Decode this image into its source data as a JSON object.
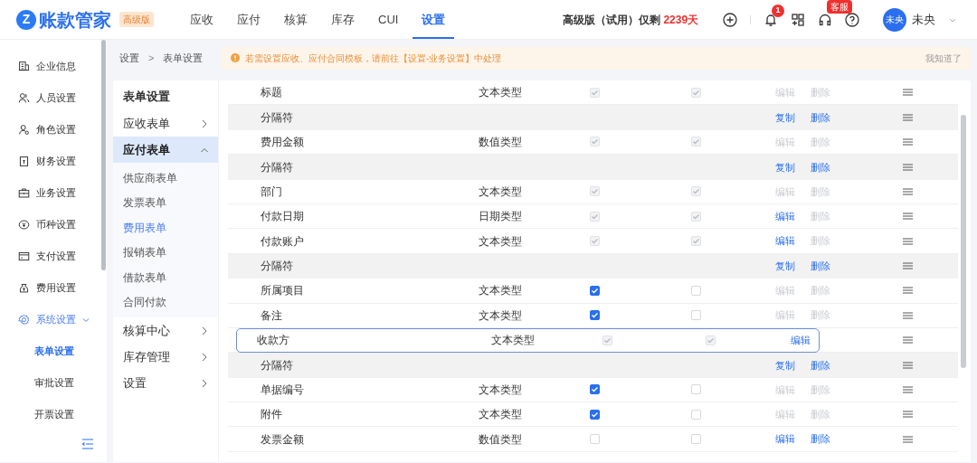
{
  "header": {
    "logo_mark": "Z",
    "logo_text": "账款管家",
    "edition_badge": "高级版",
    "nav": [
      {
        "label": "应收",
        "selected": false
      },
      {
        "label": "应付",
        "selected": false
      },
      {
        "label": "核算",
        "selected": false
      },
      {
        "label": "库存",
        "selected": false
      },
      {
        "label": "CUI",
        "selected": false
      },
      {
        "label": "设置",
        "selected": true
      }
    ],
    "trial_text": "高级版（试用）仅剩",
    "trial_days": "2239天",
    "notification_count": "1",
    "service_badge": "客服",
    "avatar": "未央",
    "user_name": "未央"
  },
  "sidebar": {
    "items": [
      {
        "label": "企业信息",
        "selected": false
      },
      {
        "label": "人员设置",
        "selected": false
      },
      {
        "label": "角色设置",
        "selected": false
      },
      {
        "label": "财务设置",
        "selected": false
      },
      {
        "label": "业务设置",
        "selected": false
      },
      {
        "label": "币种设置",
        "selected": false
      },
      {
        "label": "支付设置",
        "selected": false
      },
      {
        "label": "费用设置",
        "selected": false
      },
      {
        "label": "系统设置",
        "selected": true,
        "expanded": true,
        "children": [
          {
            "label": "表单设置",
            "selected": true
          },
          {
            "label": "审批设置",
            "selected": false
          },
          {
            "label": "开票设置",
            "selected": false
          }
        ]
      }
    ]
  },
  "breadcrumb": [
    "设置",
    ">",
    "表单设置"
  ],
  "notice": {
    "text": "若需设置应收、应付合同模板，请前往【设置-业务设置】中处理",
    "dismiss": "我知道了"
  },
  "form_menu": {
    "title": "表单设置",
    "items": [
      {
        "label": "应收表单",
        "expanded": false,
        "selected": false
      },
      {
        "label": "应付表单",
        "expanded": true,
        "selected": true,
        "children": [
          {
            "label": "供应商表单",
            "selected": false
          },
          {
            "label": "发票表单",
            "selected": false
          },
          {
            "label": "费用表单",
            "selected": true
          },
          {
            "label": "报销表单",
            "selected": false
          },
          {
            "label": "借款表单",
            "selected": false
          },
          {
            "label": "合同付款",
            "selected": false
          }
        ]
      },
      {
        "label": "核算中心",
        "expanded": false,
        "selected": false
      },
      {
        "label": "库存管理",
        "expanded": false,
        "selected": false
      },
      {
        "label": "设置",
        "expanded": false,
        "selected": false
      }
    ]
  },
  "table": {
    "rows": [
      {
        "kind": "field",
        "name": "标题",
        "type": "文本类型",
        "col_1": {
          "checked": true,
          "disabled": true
        },
        "col_2": {
          "checked": true,
          "disabled": true
        },
        "edit": {
          "label": "编辑",
          "disabled": true
        },
        "delete": {
          "label": "删除",
          "disabled": true
        }
      },
      {
        "kind": "separator",
        "name": "分隔符",
        "copy": "复制",
        "delete": {
          "label": "删除",
          "disabled": false
        }
      },
      {
        "kind": "field",
        "name": "费用金额",
        "type": "数值类型",
        "col_1": {
          "checked": true,
          "disabled": true
        },
        "col_2": {
          "checked": true,
          "disabled": true
        },
        "edit": {
          "label": "编辑",
          "disabled": true
        },
        "delete": {
          "label": "删除",
          "disabled": true
        }
      },
      {
        "kind": "separator",
        "name": "分隔符",
        "copy": "复制",
        "delete": {
          "label": "删除",
          "disabled": false
        }
      },
      {
        "kind": "field",
        "name": "部门",
        "type": "文本类型",
        "col_1": {
          "checked": true,
          "disabled": true
        },
        "col_2": {
          "checked": true,
          "disabled": true
        },
        "edit": {
          "label": "编辑",
          "disabled": true
        },
        "delete": {
          "label": "删除",
          "disabled": true
        }
      },
      {
        "kind": "field",
        "name": "付款日期",
        "type": "日期类型",
        "col_1": {
          "checked": true,
          "disabled": true
        },
        "col_2": {
          "checked": true,
          "disabled": true
        },
        "edit": {
          "label": "编辑",
          "disabled": false
        },
        "delete": {
          "label": "删除",
          "disabled": true
        }
      },
      {
        "kind": "field",
        "name": "付款账户",
        "type": "文本类型",
        "col_1": {
          "checked": true,
          "disabled": true
        },
        "col_2": {
          "checked": true,
          "disabled": true
        },
        "edit": {
          "label": "编辑",
          "disabled": false
        },
        "delete": {
          "label": "删除",
          "disabled": true
        }
      },
      {
        "kind": "separator",
        "name": "分隔符",
        "copy": "复制",
        "delete": {
          "label": "删除",
          "disabled": false
        }
      },
      {
        "kind": "field",
        "name": "所属项目",
        "type": "文本类型",
        "col_1": {
          "checked": true,
          "disabled": false
        },
        "col_2": {
          "checked": false,
          "disabled": false
        },
        "edit": {
          "label": "编辑",
          "disabled": true
        },
        "delete": {
          "label": "删除",
          "disabled": true
        }
      },
      {
        "kind": "field",
        "name": "备注",
        "type": "文本类型",
        "col_1": {
          "checked": true,
          "disabled": false
        },
        "col_2": {
          "checked": false,
          "disabled": false
        },
        "edit": {
          "label": "编辑",
          "disabled": true
        },
        "delete": {
          "label": "删除",
          "disabled": true
        }
      },
      {
        "kind": "dragging",
        "name": "收款方",
        "type": "文本类型",
        "col_1": {
          "checked": true,
          "disabled": true
        },
        "col_2": {
          "checked": true,
          "disabled": true
        },
        "edit": {
          "label": "编辑",
          "disabled": false
        }
      },
      {
        "kind": "separator",
        "name": "分隔符",
        "copy": "复制",
        "delete": {
          "label": "删除",
          "disabled": false
        }
      },
      {
        "kind": "field",
        "name": "单据编号",
        "type": "文本类型",
        "col_1": {
          "checked": true,
          "disabled": false
        },
        "col_2": {
          "checked": false,
          "disabled": false
        },
        "edit": {
          "label": "编辑",
          "disabled": true
        },
        "delete": {
          "label": "删除",
          "disabled": true
        }
      },
      {
        "kind": "field",
        "name": "附件",
        "type": "文本类型",
        "col_1": {
          "checked": true,
          "disabled": false
        },
        "col_2": {
          "checked": false,
          "disabled": false
        },
        "edit": {
          "label": "编辑",
          "disabled": true
        },
        "delete": {
          "label": "删除",
          "disabled": true
        }
      },
      {
        "kind": "field",
        "name": "发票金额",
        "type": "数值类型",
        "col_1": {
          "checked": false,
          "disabled": false
        },
        "col_2": {
          "checked": false,
          "disabled": false
        },
        "edit": {
          "label": "编辑",
          "disabled": false
        },
        "delete": {
          "label": "删除",
          "disabled": false
        }
      }
    ]
  }
}
